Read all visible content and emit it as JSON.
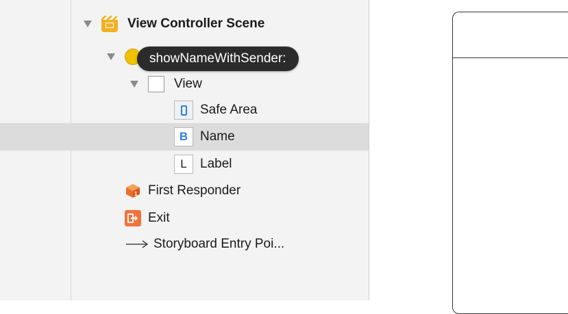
{
  "outline": {
    "scene": {
      "label": "View Controller Scene",
      "icon": "scene-icon"
    },
    "view_controller": {
      "icon": "view-controller-icon"
    },
    "view": {
      "label": "View"
    },
    "safe_area": {
      "label": "Safe Area",
      "icon": "safe-area-icon"
    },
    "name": {
      "label": "Name",
      "icon_letter": "B"
    },
    "label": {
      "label": "Label",
      "icon_letter": "L"
    },
    "first_responder": {
      "label": "First Responder"
    },
    "exit": {
      "label": "Exit"
    },
    "entry_point": {
      "label": "Storyboard Entry Poi..."
    }
  },
  "tooltip": {
    "text": "showNameWithSender:"
  },
  "colors": {
    "accent_blue": "#2f7fdc",
    "scene_yellow": "#f2b122",
    "exit_orange": "#f0743a",
    "selection_gray": "#dcdcdc"
  }
}
